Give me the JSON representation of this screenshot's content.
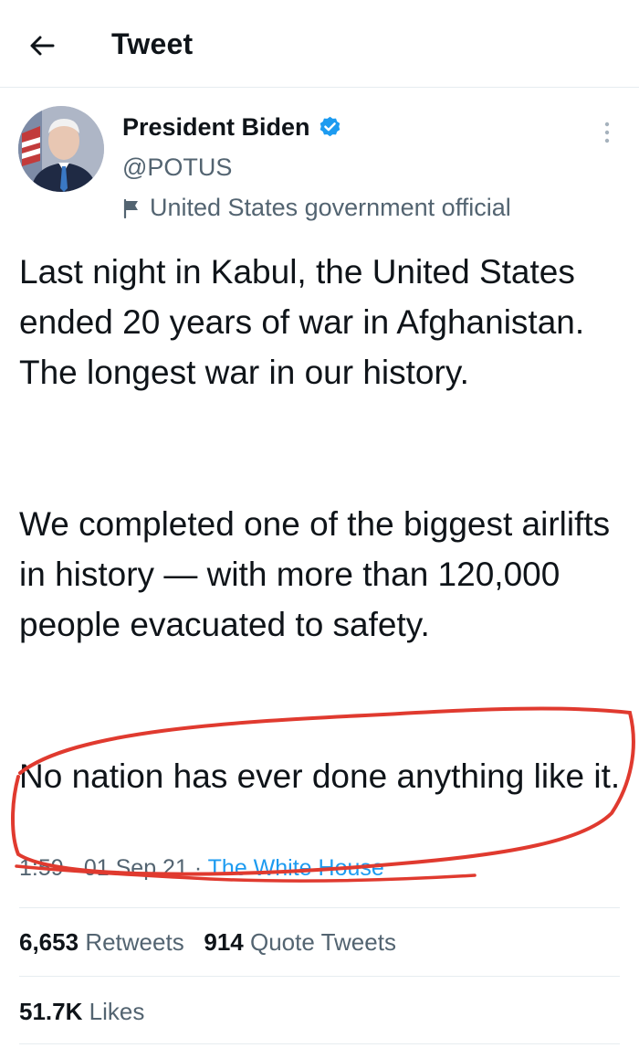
{
  "header": {
    "title": "Tweet"
  },
  "author": {
    "name": "President Biden",
    "handle": "@POTUS",
    "label": "United States government official"
  },
  "tweet": {
    "paragraphs": [
      "Last night in Kabul, the United States ended 20 years of war in Afghanistan. The longest war in our history.",
      "We completed one of the biggest airlifts in history — with more than 120,000 people evacuated to safety.",
      "No nation has ever done anything like it."
    ],
    "time": "1:59 · 01 Sep 21",
    "separator": " · ",
    "source": "The White House"
  },
  "stats": {
    "retweets_count": "6,653",
    "retweets_label": "Retweets",
    "quotes_count": "914",
    "quotes_label": "Quote Tweets",
    "likes_count": "51.7K",
    "likes_label": "Likes"
  },
  "colors": {
    "accent": "#1d9bf0",
    "secondary_text": "#536471",
    "annotation_red": "#e03a2f"
  }
}
